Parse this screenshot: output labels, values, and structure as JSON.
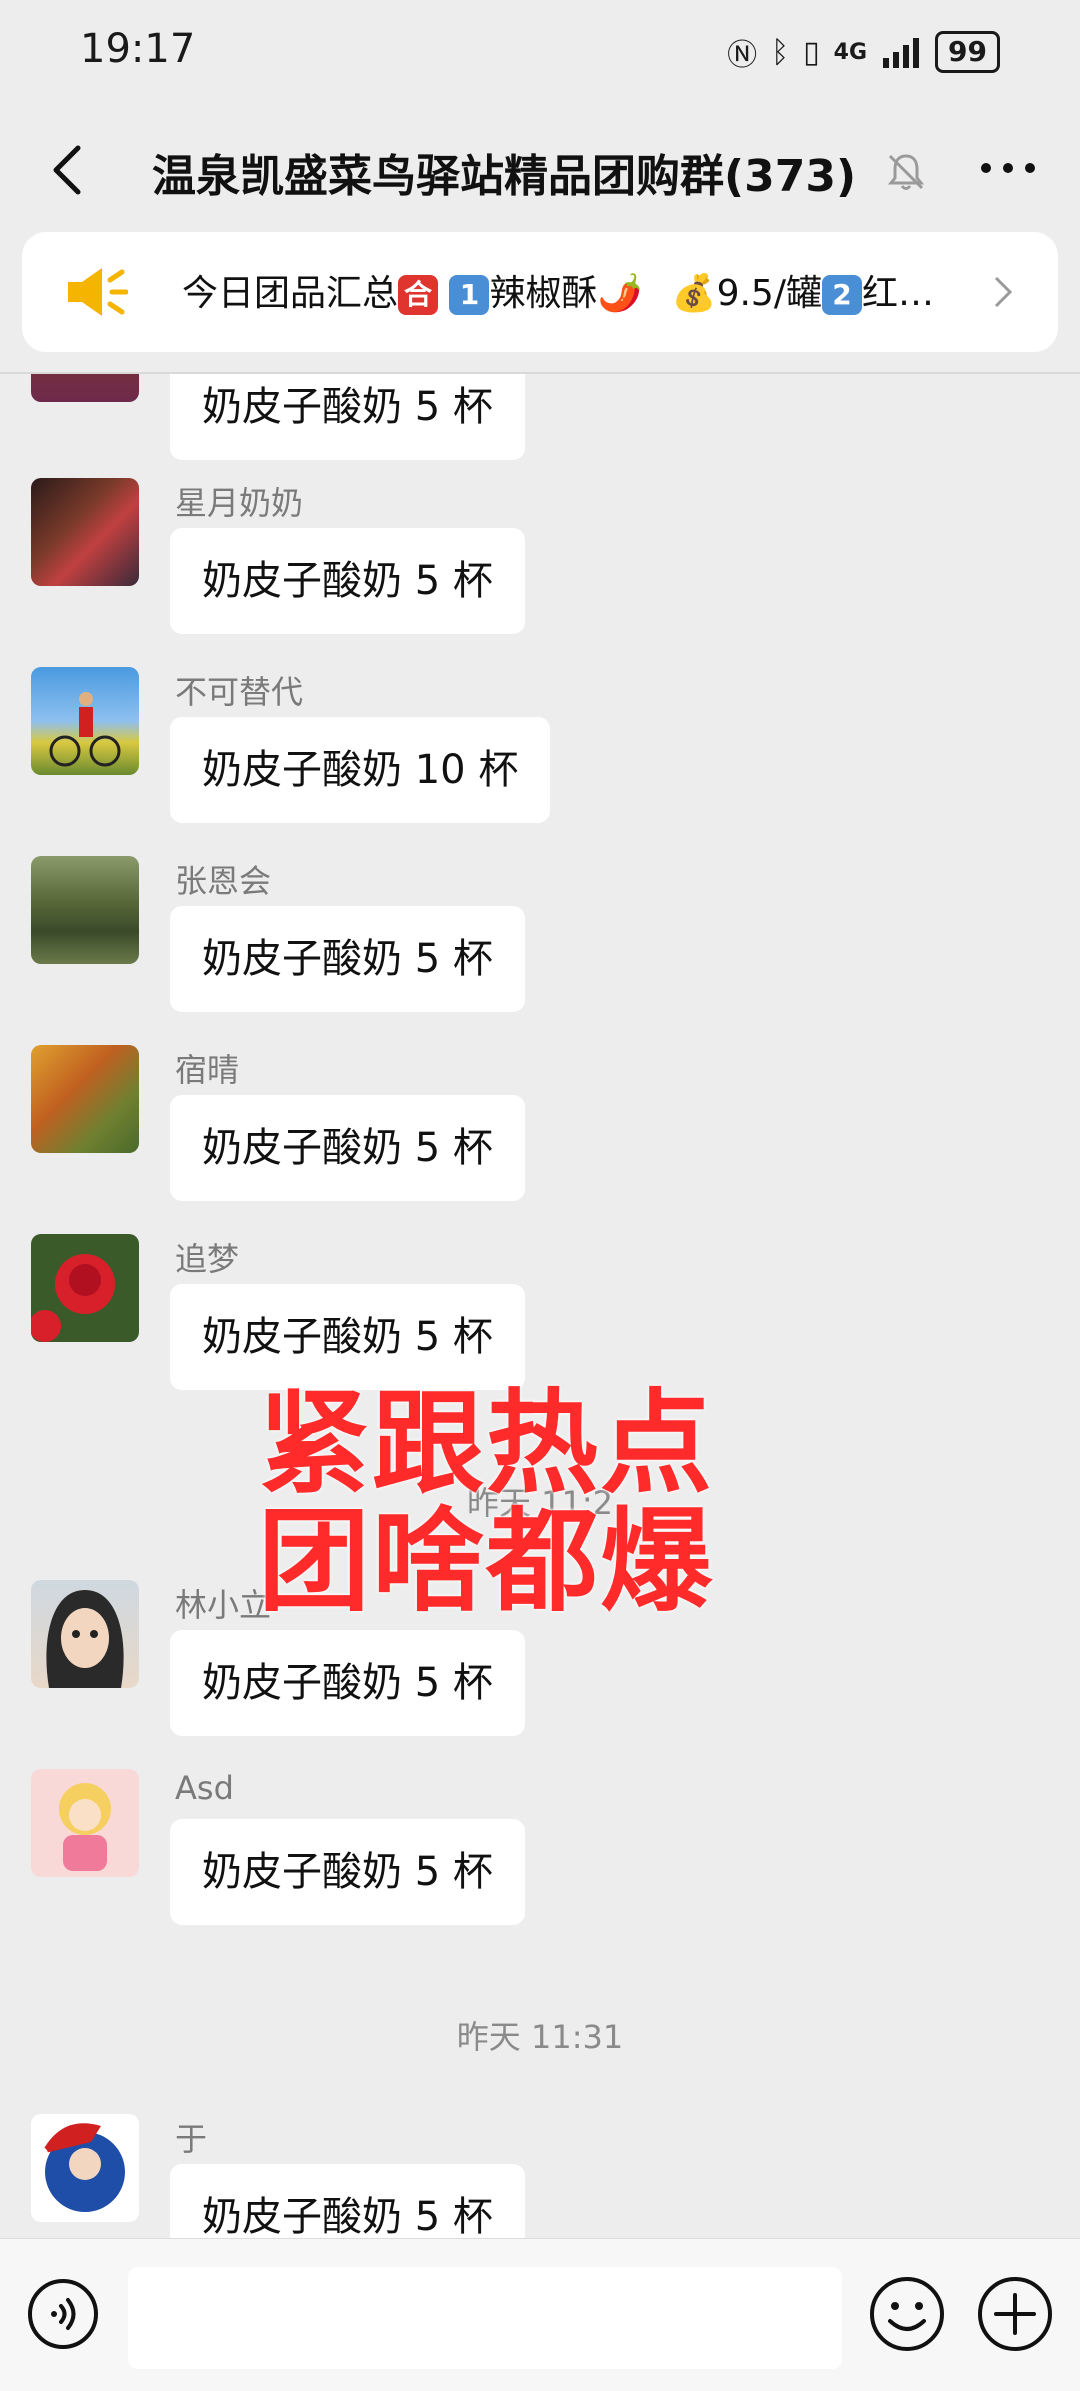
{
  "status_bar": {
    "time": "19:17",
    "network": "4G",
    "battery": "99"
  },
  "header": {
    "title": "温泉凯盛菜鸟驿站精品团购群(373)"
  },
  "notice": {
    "text": "今日团品汇总",
    "badge1": "合",
    "badge2": "1",
    "item1": "辣椒酥🌶️",
    "item2": "💰9.5/罐",
    "badge3": "2",
    "item3": "红…"
  },
  "messages": [
    {
      "sender": "",
      "text": "奶皮子酸奶 5 杯"
    },
    {
      "sender": "星月奶奶",
      "text": "奶皮子酸奶 5 杯"
    },
    {
      "sender": "不可替代",
      "text": "奶皮子酸奶 10 杯"
    },
    {
      "sender": "张恩会",
      "text": "奶皮子酸奶 5 杯"
    },
    {
      "sender": "宿晴",
      "text": "奶皮子酸奶 5 杯"
    },
    {
      "sender": "追梦",
      "text": "奶皮子酸奶 5 杯"
    },
    {
      "sender": "林小立",
      "text": "奶皮子酸奶 5 杯"
    },
    {
      "sender": "Asd",
      "text": "奶皮子酸奶 5 杯"
    },
    {
      "sender": "于",
      "text": "奶皮子酸奶 5 杯"
    }
  ],
  "time_separators": [
    "昨天 11:2",
    "昨天 11:31"
  ],
  "overlay": {
    "line1": "紧跟热点",
    "line2": "团啥都爆"
  },
  "colors": {
    "background": "#ededed",
    "overlay_text": "#ff2a2a",
    "bubble": "#ffffff",
    "badge_red": "#e0342f",
    "badge_blue": "#4a8fd6"
  }
}
